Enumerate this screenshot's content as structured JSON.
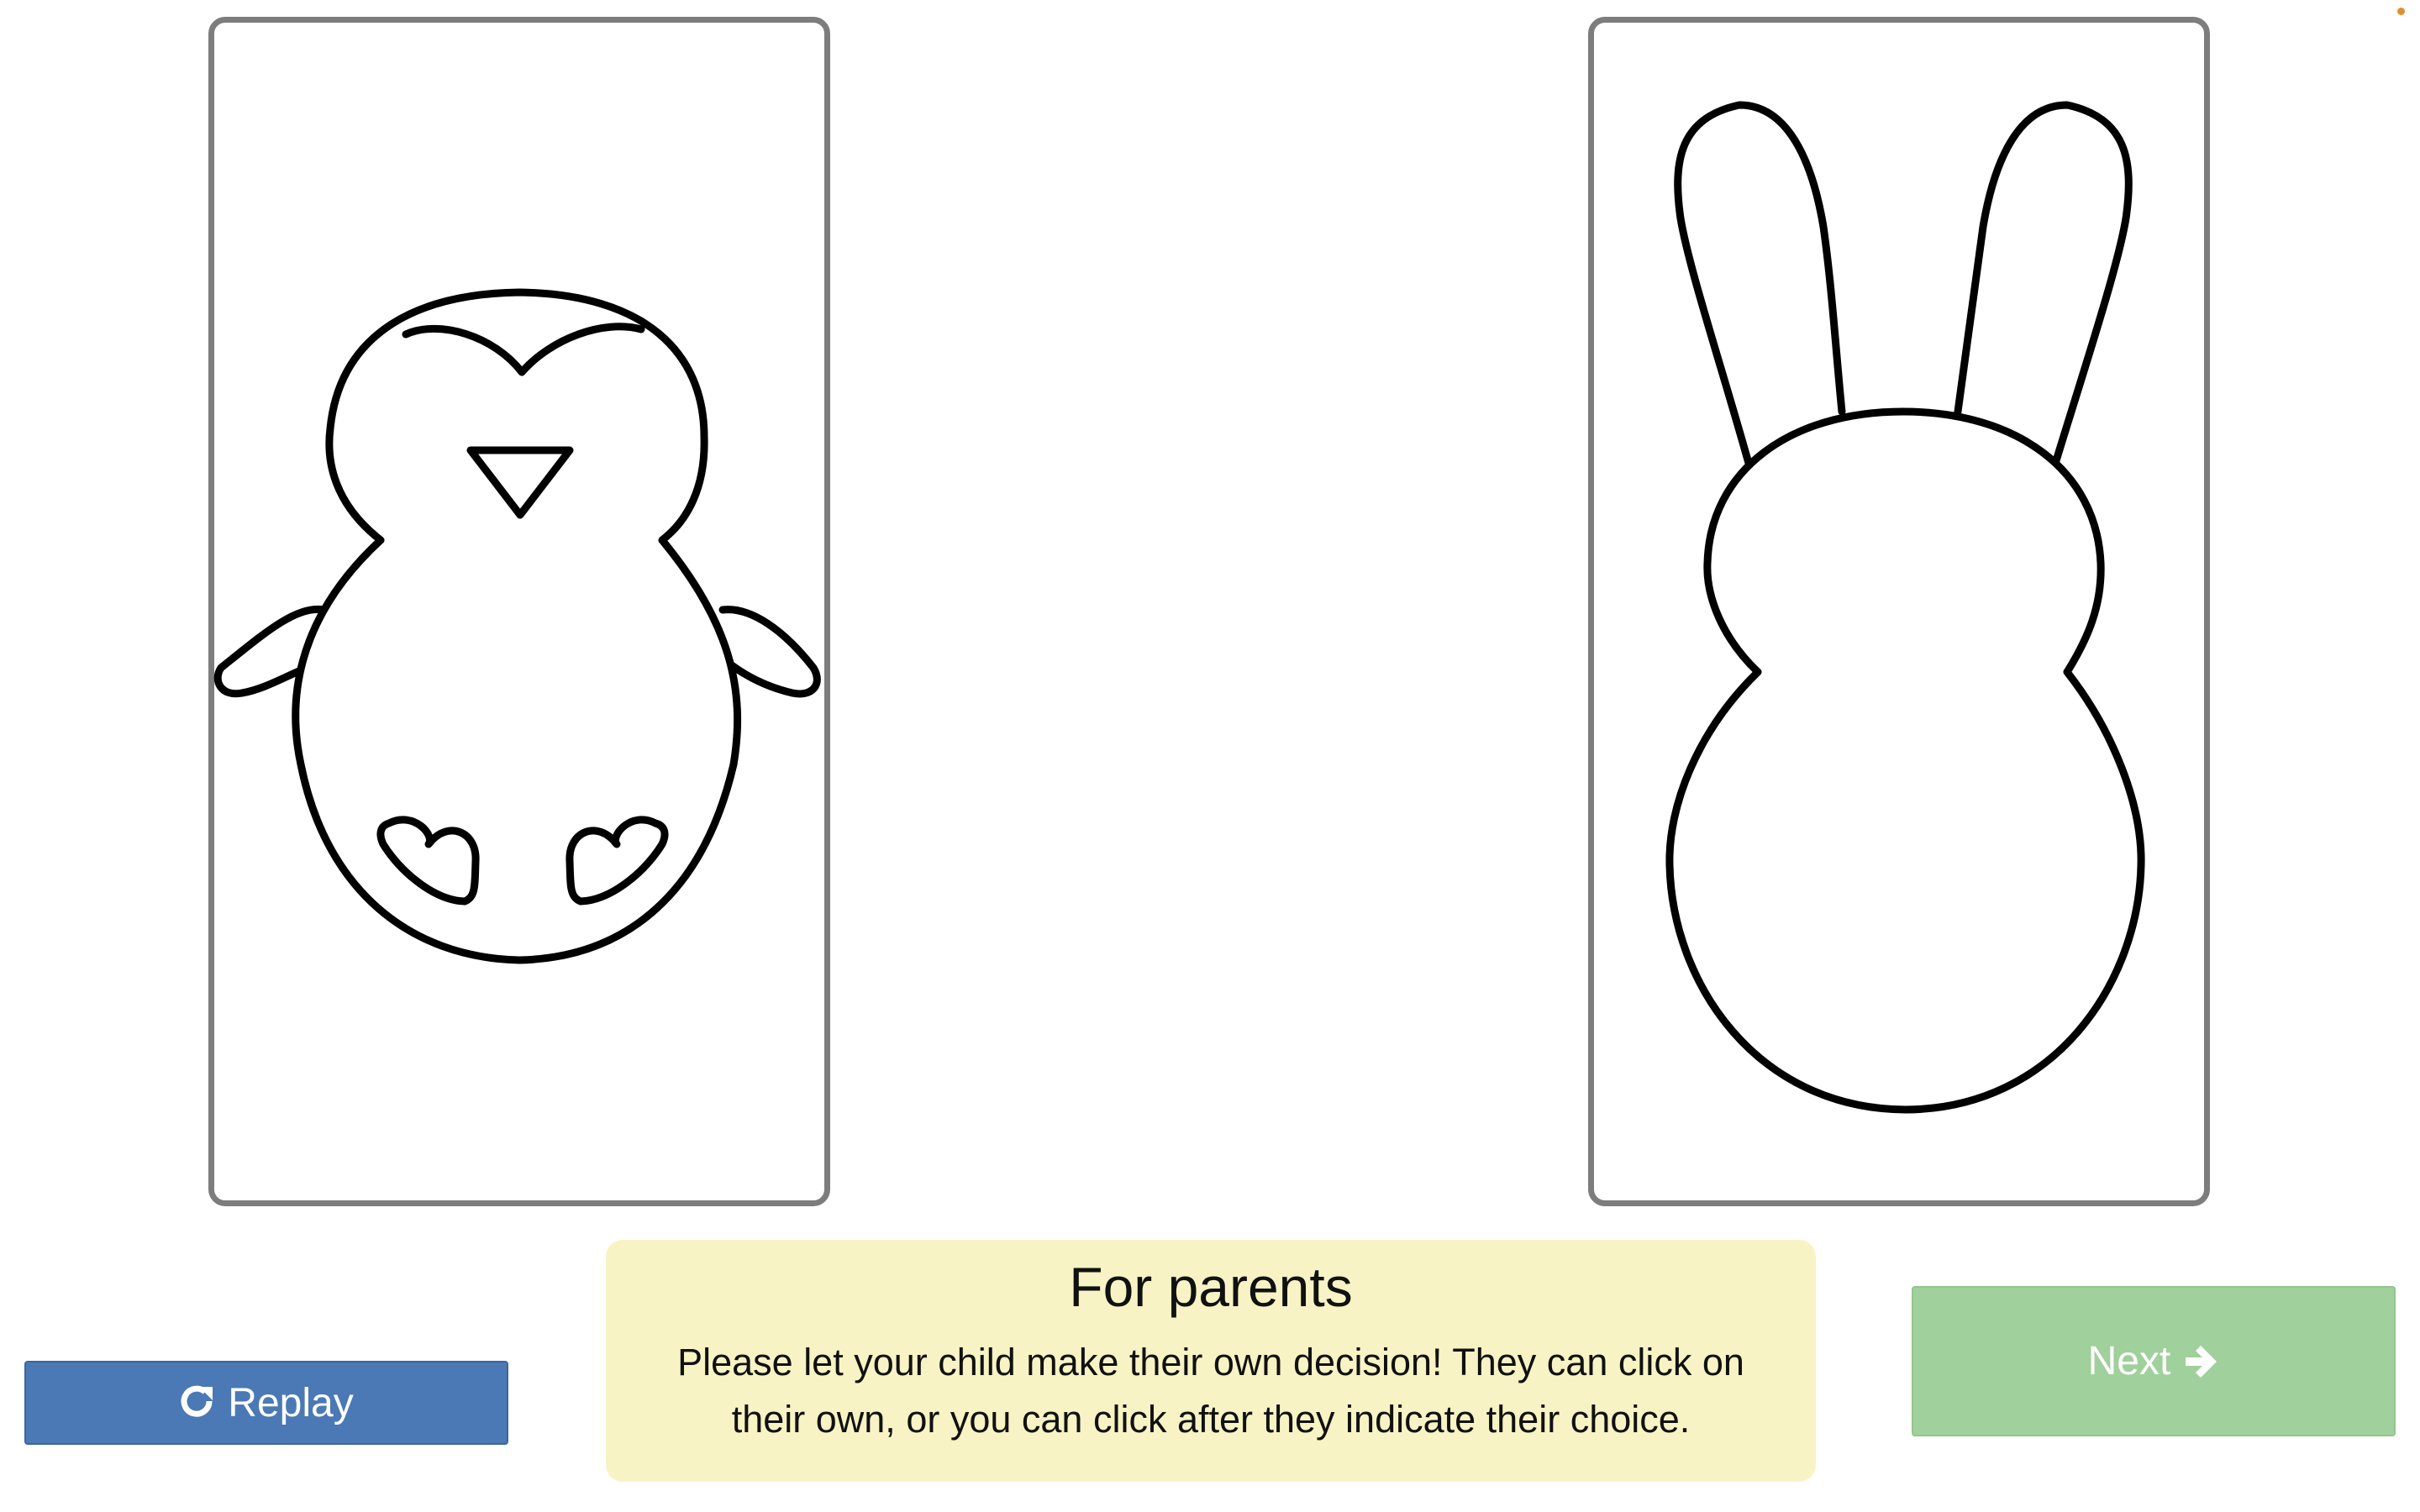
{
  "choices": [
    {
      "name": "penguin",
      "icon": "penguin-outline"
    },
    {
      "name": "bunny",
      "icon": "bunny-outline"
    }
  ],
  "parents_box": {
    "title": "For parents",
    "text": "Please let your child make their own decision! They can click on their own, or you can click after they indicate their choice."
  },
  "buttons": {
    "replay_label": "Replay",
    "next_label": "Next",
    "replay_icon": "refresh-icon",
    "next_icon": "arrow-right-icon"
  },
  "colors": {
    "replay_button": "#4a79b5",
    "next_button": "#a0d09b",
    "parents_box_bg": "#f7f3c4",
    "card_border": "#7d7d7d"
  }
}
